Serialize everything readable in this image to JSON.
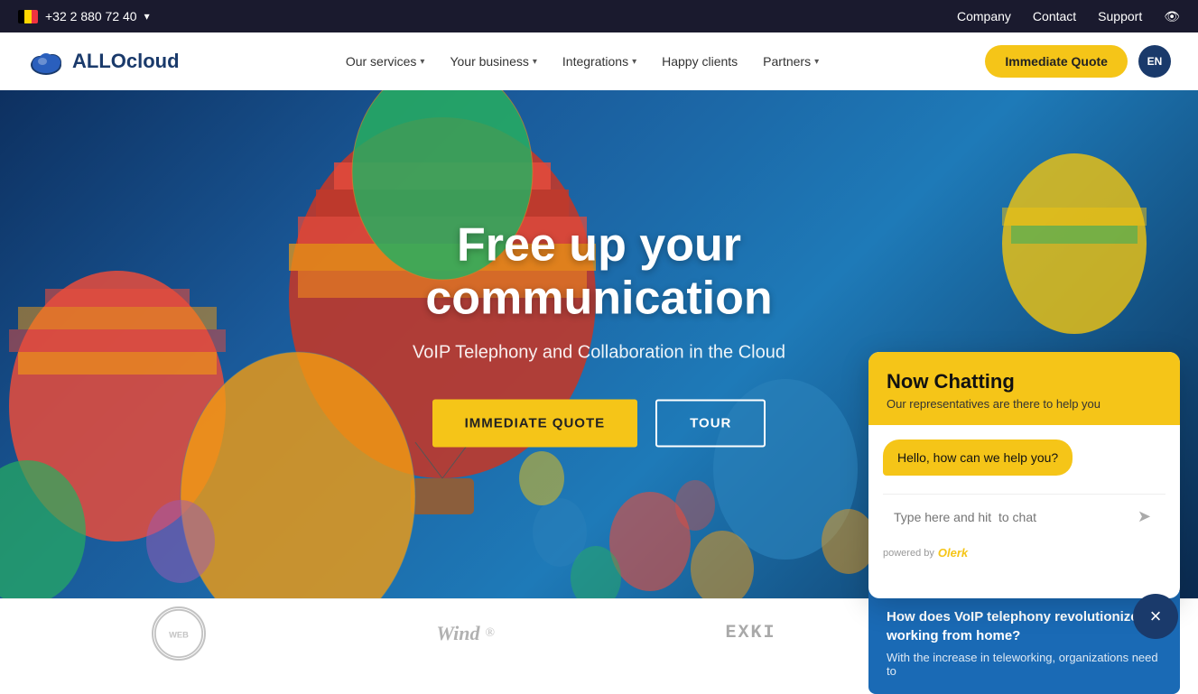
{
  "topbar": {
    "phone": "+32 2 880 72 40",
    "dropdown_label": "▾",
    "nav_items": [
      "Company",
      "Contact",
      "Support"
    ],
    "eye_icon": "👁"
  },
  "navbar": {
    "logo_text": "ALLOcloud",
    "nav_links": [
      {
        "label": "Our services",
        "has_dropdown": true
      },
      {
        "label": "Your business",
        "has_dropdown": true
      },
      {
        "label": "Integrations",
        "has_dropdown": true
      },
      {
        "label": "Happy clients",
        "has_dropdown": false
      },
      {
        "label": "Partners",
        "has_dropdown": true
      }
    ],
    "cta_button": "Immediate Quote",
    "lang": "EN"
  },
  "hero": {
    "title": "Free up your communication",
    "subtitle": "VoIP Telephony and Collaboration in the Cloud",
    "btn_immediate": "IMMEDIATE QUOTE",
    "btn_tour": "TOUR"
  },
  "chat": {
    "header_title": "Now Chatting",
    "header_sub": "Our representatives are there to help you",
    "bubble": "Hello, how can we help you?",
    "input_placeholder": "Type here and hit  to chat",
    "powered_by": "powered by",
    "brand": "Olerk",
    "send_icon": "➤"
  },
  "blog": {
    "title": "How does VoIP telephony revolutionize working from home?",
    "teaser": "With the increase in teleworking, organizations need to"
  },
  "partners": [
    {
      "label": "WEB",
      "type": "circle"
    },
    {
      "label": "Wind",
      "type": "text"
    },
    {
      "label": "EXKI",
      "type": "text"
    },
    {
      "label": "grid",
      "type": "dots"
    }
  ],
  "close_btn": "×"
}
